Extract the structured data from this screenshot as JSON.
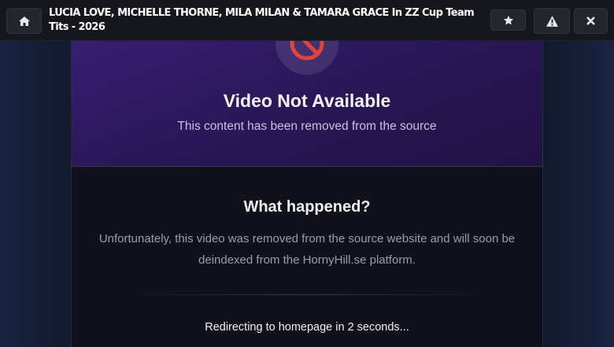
{
  "header": {
    "title": "LUCIA LOVE, MICHELLE THORNE, MILA MILAN & TAMARA GRACE In ZZ Cup Team Tits - 2026",
    "home_icon": "home-icon",
    "favorite_icon": "star-icon",
    "report_icon": "warning-icon",
    "close_icon": "close-icon"
  },
  "notice": {
    "icon": "prohibited-icon",
    "title": "Video Not Available",
    "subtitle": "This content has been removed from the source"
  },
  "details": {
    "heading": "What happened?",
    "body": "Unfortunately, this video was removed from the source website and will soon be deindexed from the HornyHill.se platform.",
    "redirect": "Redirecting to homepage in 2 seconds..."
  },
  "colors": {
    "accent": "#3a2079",
    "danger": "#e0443c",
    "topbar": "#15171c",
    "card": "#11111c"
  }
}
